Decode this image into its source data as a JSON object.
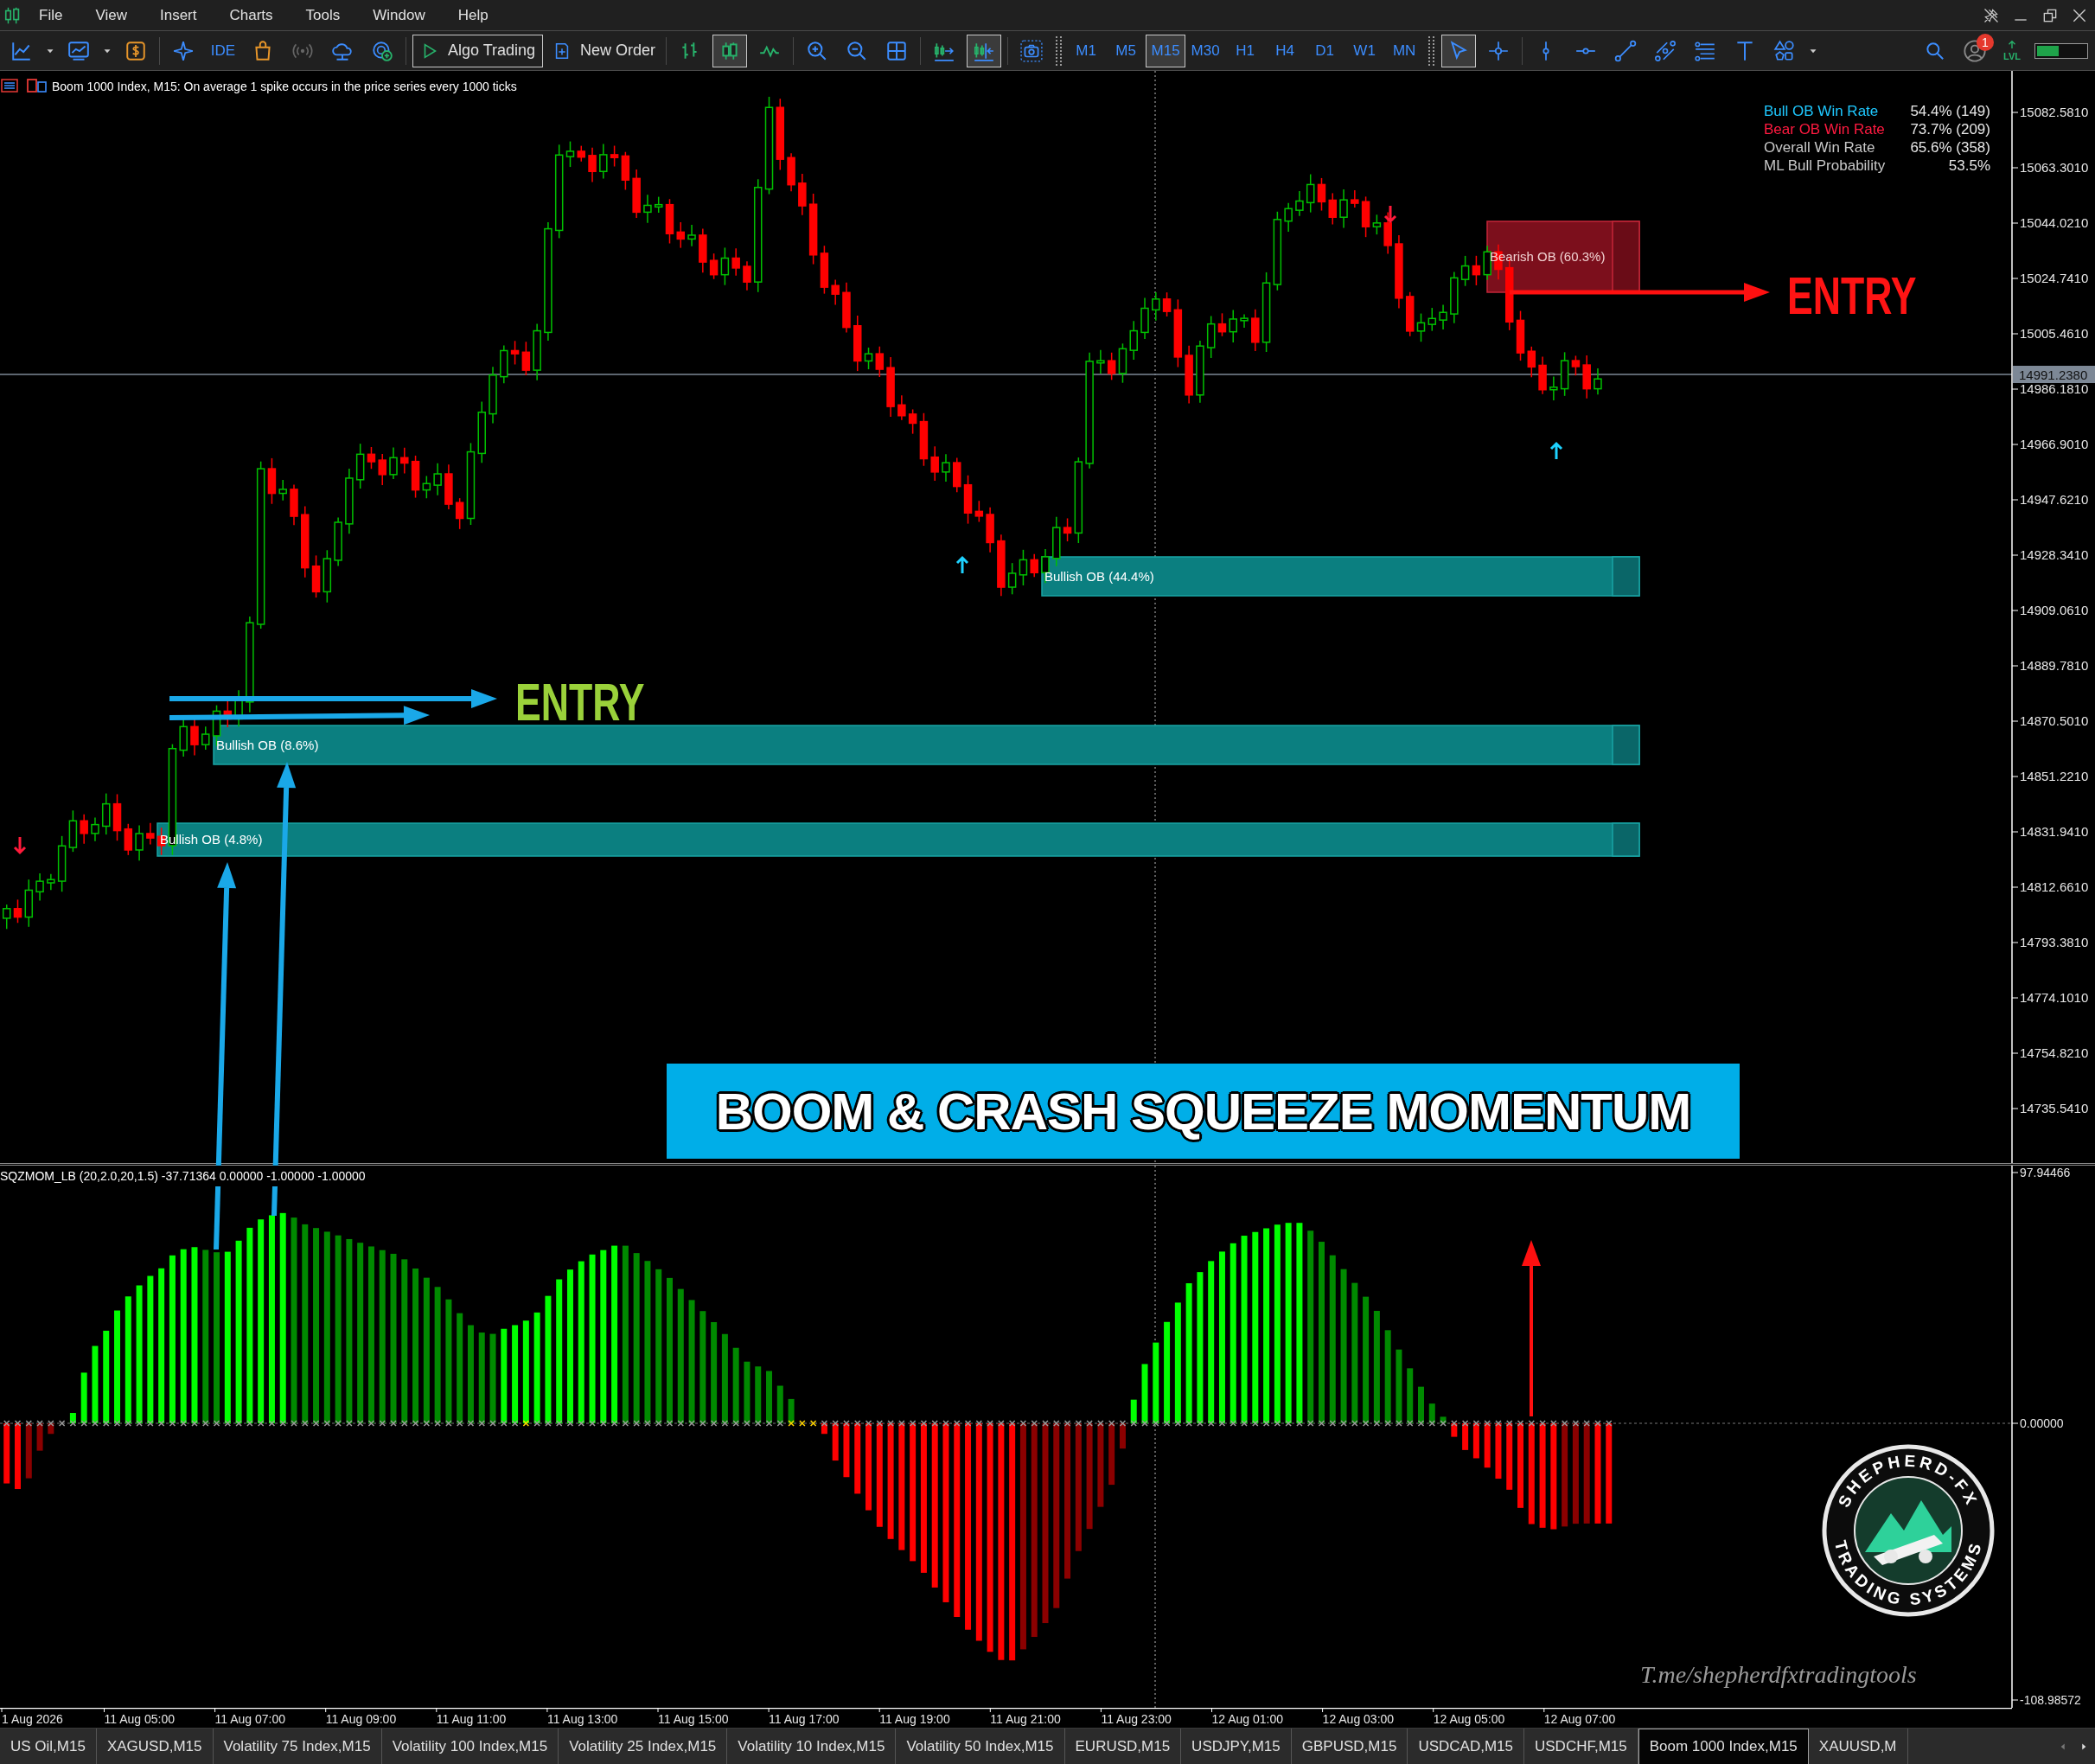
{
  "menu": [
    "File",
    "View",
    "Insert",
    "Charts",
    "Tools",
    "Window",
    "Help"
  ],
  "toolbar": {
    "ide": "IDE",
    "algo_trading": "Algo Trading",
    "new_order": "New Order",
    "chart_types": [
      {
        "selected": false
      },
      {
        "selected": true
      },
      {
        "selected": false
      }
    ],
    "scroll_modes": [
      {
        "selected": false
      },
      {
        "selected": true
      }
    ],
    "timeframes": [
      {
        "label": "M1",
        "selected": false
      },
      {
        "label": "M5",
        "selected": false
      },
      {
        "label": "M15",
        "selected": true
      },
      {
        "label": "M30",
        "selected": false
      },
      {
        "label": "H1",
        "selected": false
      },
      {
        "label": "H4",
        "selected": false
      },
      {
        "label": "D1",
        "selected": false
      },
      {
        "label": "W1",
        "selected": false
      },
      {
        "label": "MN",
        "selected": false
      }
    ],
    "cursor_modes": [
      {
        "selected": true
      },
      {
        "selected": false
      }
    ],
    "notifications": "1",
    "level": "LVL"
  },
  "chart": {
    "info": "Boom 1000 Index, M15:  On average 1 spike occurs in the price series every 1000 ticks",
    "price_ticks": [
      "15082.5810",
      "15063.3010",
      "15044.0210",
      "15024.7410",
      "15005.4610",
      "14986.1810",
      "14966.9010",
      "14947.6210",
      "14928.3410",
      "14909.0610",
      "14889.7810",
      "14870.5010",
      "14851.2210",
      "14831.9410",
      "14812.6610",
      "14793.3810",
      "14774.1010",
      "14754.8210",
      "14735.5410"
    ],
    "current_price": "14991.2380",
    "stats": [
      {
        "label": "Bull OB Win Rate",
        "value": "54.4% (149)",
        "color": "#1ec8ff"
      },
      {
        "label": "Bear OB Win Rate",
        "value": "73.7% (209)",
        "color": "#ff1a40"
      },
      {
        "label": "Overall Win Rate",
        "value": "65.6% (358)",
        "color": "#c8c8c8"
      },
      {
        "label": "ML Bull Probability",
        "value": "53.5%",
        "color": "#c8c8c8"
      }
    ],
    "order_blocks": [
      {
        "kind": "bearish",
        "label": "Bearish OB (60.3%)"
      },
      {
        "kind": "bullish",
        "label": "Bullish OB (44.4%)"
      },
      {
        "kind": "bullish",
        "label": "Bullish OB (8.6%)"
      },
      {
        "kind": "bullish",
        "label": "Bullish OB (4.8%)"
      }
    ],
    "entry_labels": [
      {
        "kind": "bullish",
        "text": "ENTRY"
      },
      {
        "kind": "bearish",
        "text": "ENTRY"
      }
    ],
    "banner": "BOOM & CRASH SQUEEZE MOMENTUM"
  },
  "indicator": {
    "label": "SQZMOM_LB (20,2.0,20,1.5) -37.71364 0.00000 -1.00000 -1.00000",
    "scale_ticks": [
      "97.94466",
      "0.00000",
      "-108.98572"
    ],
    "link": "T.me/shepherdfxtradingtools",
    "logo": {
      "top": "SHEPHERD-FX",
      "bottom": "TRADING SYSTEMS"
    }
  },
  "time_axis": [
    "1 Aug 2026",
    "11 Aug 05:00",
    "11 Aug 07:00",
    "11 Aug 09:00",
    "11 Aug 11:00",
    "11 Aug 13:00",
    "11 Aug 15:00",
    "11 Aug 17:00",
    "11 Aug 19:00",
    "11 Aug 21:00",
    "11 Aug 23:00",
    "12 Aug 01:00",
    "12 Aug 03:00",
    "12 Aug 05:00",
    "12 Aug 07:00"
  ],
  "symbol_tabs": [
    {
      "label": "US Oil,M15",
      "selected": false
    },
    {
      "label": "XAGUSD,M15",
      "selected": false
    },
    {
      "label": "Volatility 75 Index,M15",
      "selected": false
    },
    {
      "label": "Volatility 100 Index,M15",
      "selected": false
    },
    {
      "label": "Volatility 25 Index,M15",
      "selected": false
    },
    {
      "label": "Volatility 10 Index,M15",
      "selected": false
    },
    {
      "label": "Volatility 50 Index,M15",
      "selected": false
    },
    {
      "label": "EURUSD,M15",
      "selected": false
    },
    {
      "label": "USDJPY,M15",
      "selected": false
    },
    {
      "label": "GBPUSD,M15",
      "selected": false
    },
    {
      "label": "USDCAD,M15",
      "selected": false
    },
    {
      "label": "USDCHF,M15",
      "selected": false
    },
    {
      "label": "Boom 1000 Index,M15",
      "selected": true
    },
    {
      "label": "XAUUSD,M",
      "selected": false
    }
  ]
}
